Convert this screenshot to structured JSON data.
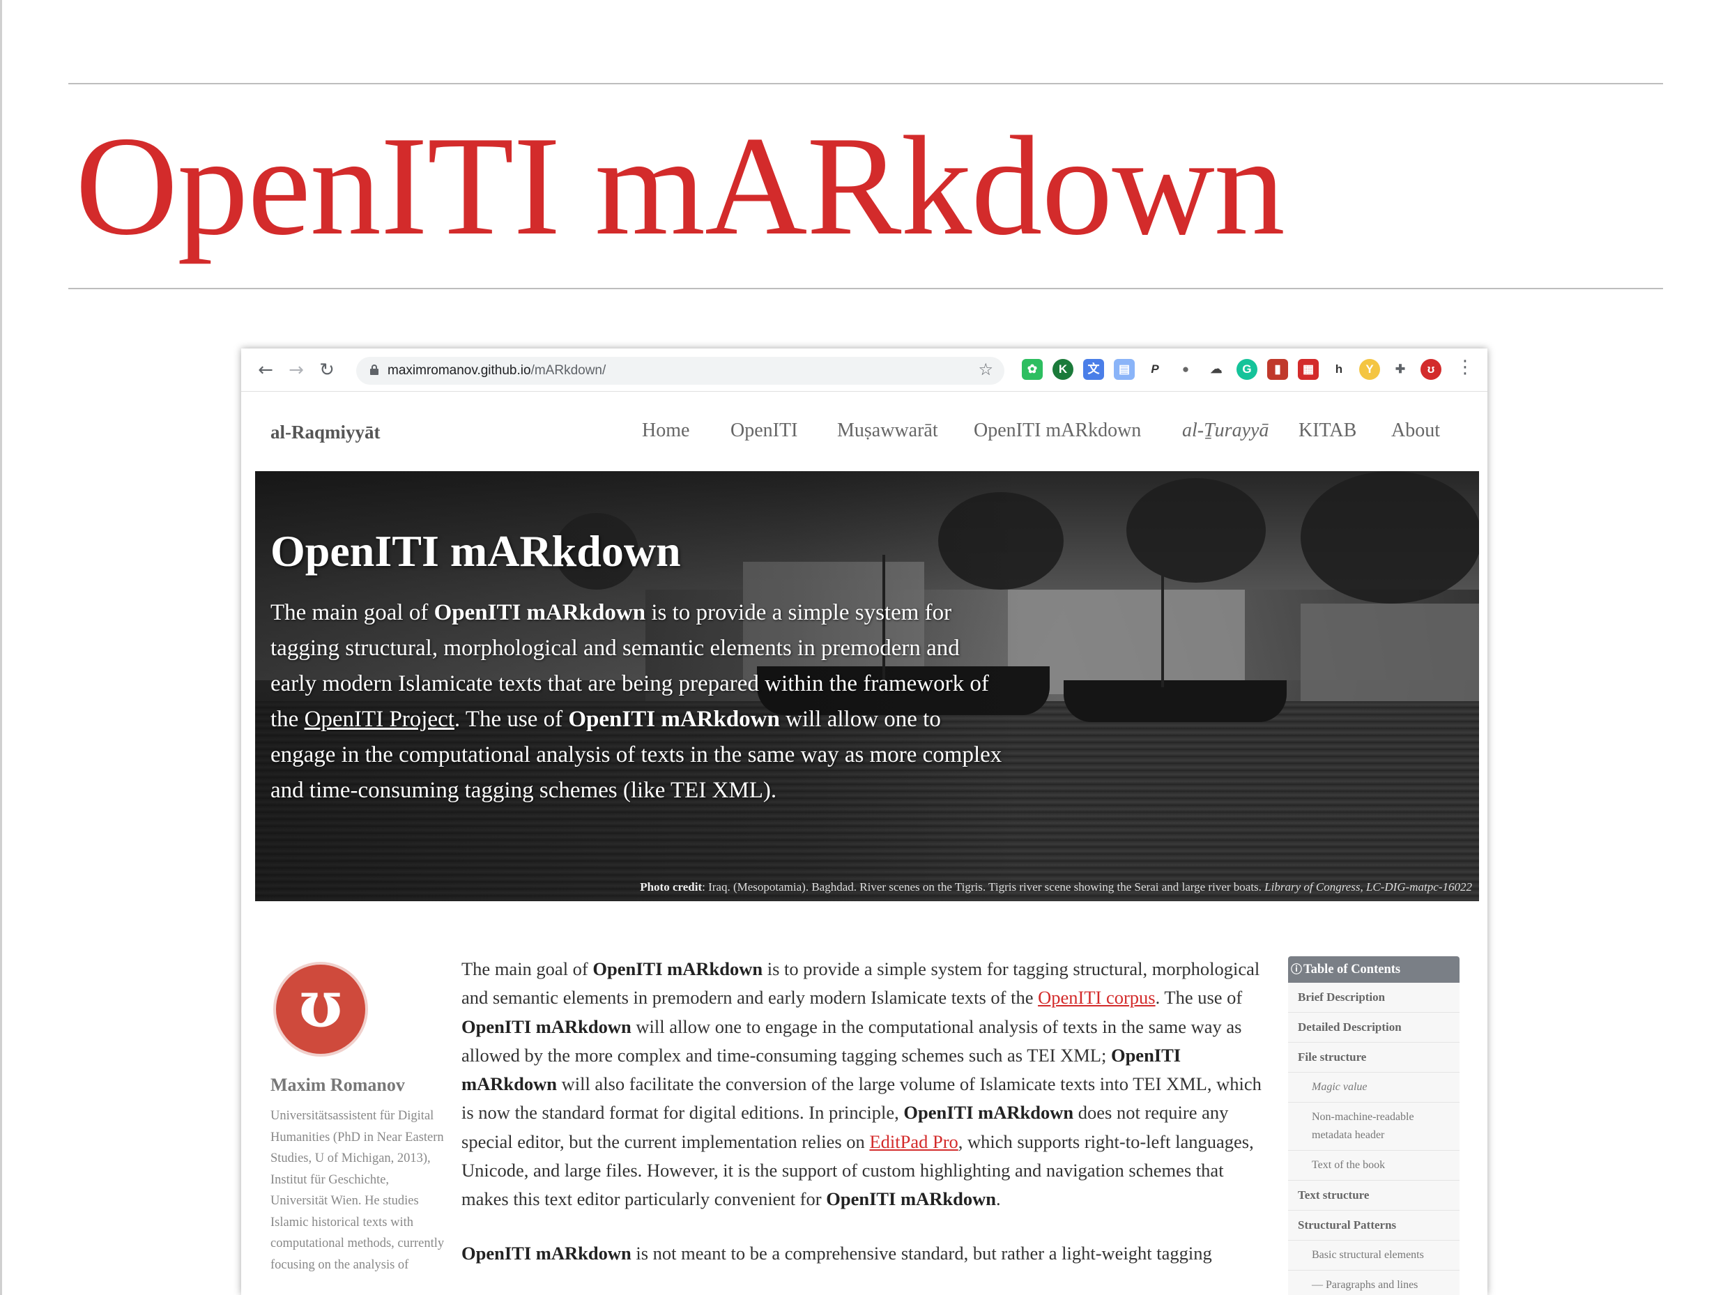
{
  "slide": {
    "title": "OpenITI mARkdown"
  },
  "browser": {
    "url_host": "maximromanov.github.io",
    "url_path": "/mARkdown/",
    "colors": {
      "accent": "#d32b2b"
    },
    "toolbar_icons": [
      "back-arrow-icon",
      "forward-arrow-icon",
      "reload-icon",
      "lock-icon",
      "star-icon",
      "kebab-menu-icon"
    ]
  },
  "site": {
    "brand": "al-Raqmiyyāt",
    "nav": [
      {
        "label": "Home"
      },
      {
        "label": "OpenITI"
      },
      {
        "label": "Muṣawwarāt"
      },
      {
        "label": "OpenITI mARkdown"
      },
      {
        "label": "al-Ṯurayyā"
      },
      {
        "label": "KITAB"
      },
      {
        "label": "About"
      }
    ]
  },
  "hero": {
    "title": "OpenITI mARkdown",
    "p1": "The main goal of ",
    "b1": "OpenITI mARkdown",
    "p2": " is to provide a simple system for tagging structural, morphological and semantic elements in premodern and early modern Islamicate texts that are being prepared within the framework of the ",
    "link": "OpenITI Project",
    "p3": ". The use of ",
    "b2": "OpenITI mARkdown",
    "p4": " will allow one to engage in the computational analysis of texts in the same way as more complex and time-consuming tagging schemes (like TEI XML).",
    "credit_label": "Photo credit",
    "credit_text": ": Iraq. (Mesopotamia). Baghdad. River scenes on the Tigris. Tigris river scene showing the Serai and large river boats. ",
    "credit_source": "Library of Congress, LC-DIG-matpc-16022"
  },
  "author": {
    "name": "Maxim Romanov",
    "bio": "Universitätsassistent für Digital Humanities (PhD in Near Eastern Studies, U of Michigan, 2013), Institut für Geschichte, Universität Wien. He studies Islamic historical texts with computational methods, currently focusing on the analysis of"
  },
  "content": {
    "p1": {
      "t1": "The main goal of ",
      "b1": "OpenITI mARkdown",
      "t2": " is to provide a simple system for tagging structural, morphological and semantic elements in premodern and early modern Islamicate texts of the ",
      "link1": "OpenITI corpus",
      "t3": ". The use of ",
      "b2": "OpenITI mARkdown",
      "t4": " will allow one to engage in the computational analysis of texts in the same way as allowed by the more complex and time-consuming tagging schemes such as TEI XML; ",
      "b3": "OpenITI mARkdown",
      "t5": " will also facilitate the conversion of the large volume of Islamicate texts into TEI XML, which is now the standard format for digital editions. In principle, ",
      "b4": "OpenITI mARkdown",
      "t6": " does not require any special editor, but the current implementation relies on ",
      "link2": "EditPad Pro",
      "t7": ", which supports right-to-left languages, Unicode, and large files. However, it is the support of custom highlighting and navigation schemes that makes this text editor particularly convenient for ",
      "b5": "OpenITI mARkdown",
      "t8": "."
    },
    "p2": {
      "b1": "OpenITI mARkdown",
      "t1": " is not meant to be a comprehensive standard, but rather a light-weight tagging"
    }
  },
  "toc": {
    "title": "Table of Contents",
    "items": [
      {
        "label": "Brief Description"
      },
      {
        "label": "Detailed Description"
      },
      {
        "label": "File structure"
      },
      {
        "label": "Magic value"
      },
      {
        "label": "Non-machine-readable metadata header"
      },
      {
        "label": "Text of the book"
      },
      {
        "label": "Text structure"
      },
      {
        "label": "Structural Patterns"
      },
      {
        "label": "Basic structural elements"
      },
      {
        "label": "— Paragraphs and lines"
      }
    ]
  }
}
